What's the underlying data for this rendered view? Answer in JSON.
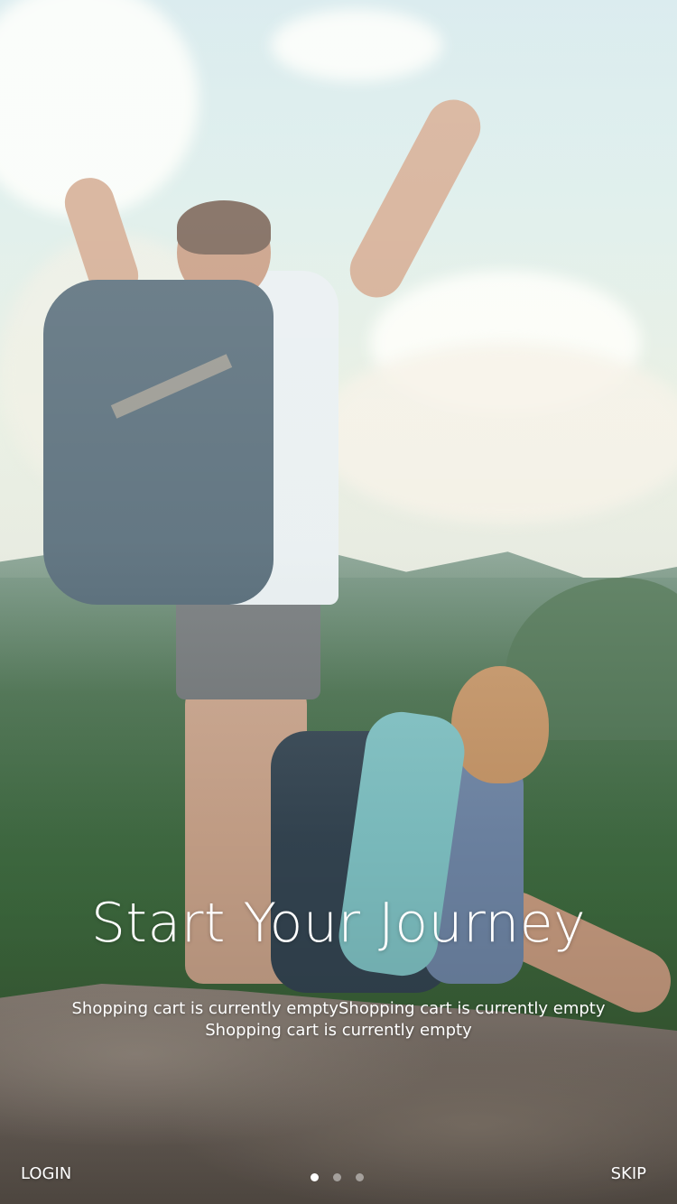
{
  "onboarding": {
    "headline": "Start Your Journey",
    "subtitle_line1": "Shopping cart is currently emptyShopping cart is currently empty",
    "subtitle_line2": "Shopping cart is currently empty"
  },
  "bottom_bar": {
    "login_label": "LOGIN",
    "skip_label": "SKIP",
    "pages": {
      "count": 3,
      "active_index": 0
    }
  },
  "colors": {
    "text": "#ffffff",
    "dot_inactive": "rgba(255,255,255,0.45)",
    "dot_active": "#ffffff"
  }
}
